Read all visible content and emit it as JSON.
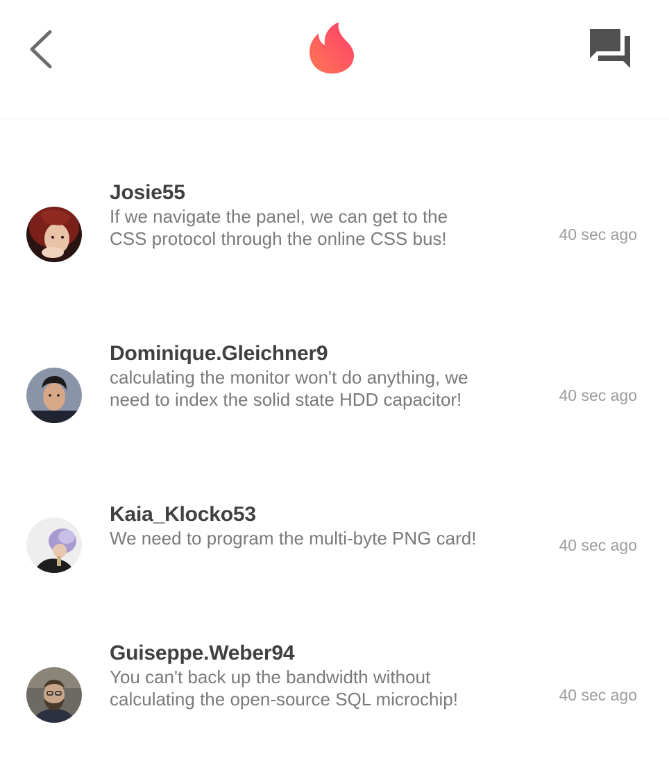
{
  "header": {
    "back_icon": "chevron-left-icon",
    "logo_icon": "flame-logo-icon",
    "chat_icon": "chat-bubbles-icon",
    "logo_gradient": [
      "#fd5068",
      "#ff7854"
    ],
    "icon_color": "#505050"
  },
  "messages": [
    {
      "username": "Josie55",
      "text": "If we navigate the panel, we can get to the CSS protocol through the online CSS bus!",
      "time": "40 sec ago"
    },
    {
      "username": "Dominique.Gleichner9",
      "text": "calculating the monitor won't do anything, we need to index the solid state HDD capacitor!",
      "time": "40 sec ago"
    },
    {
      "username": "Kaia_Klocko53",
      "text": "We need to program the multi-byte PNG card!",
      "time": "40 sec ago"
    },
    {
      "username": "Guiseppe.Weber94",
      "text": "You can't back up the bandwidth without calculating the open-source SQL microchip!",
      "time": "40 sec ago"
    }
  ]
}
